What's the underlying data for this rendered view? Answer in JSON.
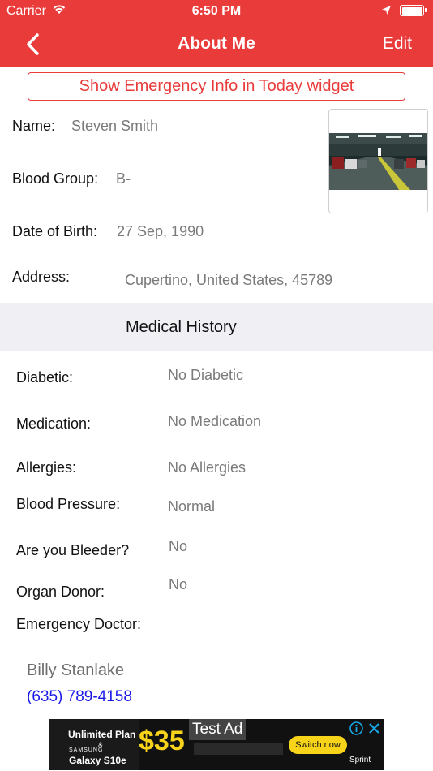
{
  "status_bar": {
    "carrier": "Carrier",
    "time": "6:50 PM"
  },
  "nav": {
    "title": "About Me",
    "edit_label": "Edit"
  },
  "widget_button": {
    "label": "Show Emergency Info in Today widget"
  },
  "profile": {
    "name_label": "Name:",
    "name": "Steven Smith",
    "blood_group_label": "Blood Group:",
    "blood_group": "B-",
    "dob_label": "Date of Birth:",
    "dob": "27 Sep, 1990",
    "address_label": "Address:",
    "address": "Cupertino, United States, 45789"
  },
  "medical_history": {
    "title": "Medical History",
    "rows": [
      {
        "label": "Diabetic:",
        "value": "No Diabetic"
      },
      {
        "label": "Medication:",
        "value": "No Medication"
      },
      {
        "label": "Allergies:",
        "value": "No Allergies"
      },
      {
        "label": "Blood Pressure:",
        "value": "Normal"
      },
      {
        "label": "Are you Bleeder?",
        "value": "No"
      },
      {
        "label": "Organ Donor:",
        "value": "No"
      }
    ],
    "doctor_label": "Emergency Doctor:"
  },
  "doctor": {
    "name": "Billy Stanlake",
    "phone": "(635) 789-4158"
  },
  "ad": {
    "badge": "Test Ad",
    "plan": "Unlimited Plan",
    "amp": "&",
    "brand": "SAMSUNG",
    "device": "Galaxy S10e",
    "price": "$35",
    "cta": "Switch now",
    "advertiser": "Sprint"
  },
  "colors": {
    "accent": "#ea3b3b",
    "link": "#1a1ae6",
    "section_bg": "#efeff4"
  }
}
